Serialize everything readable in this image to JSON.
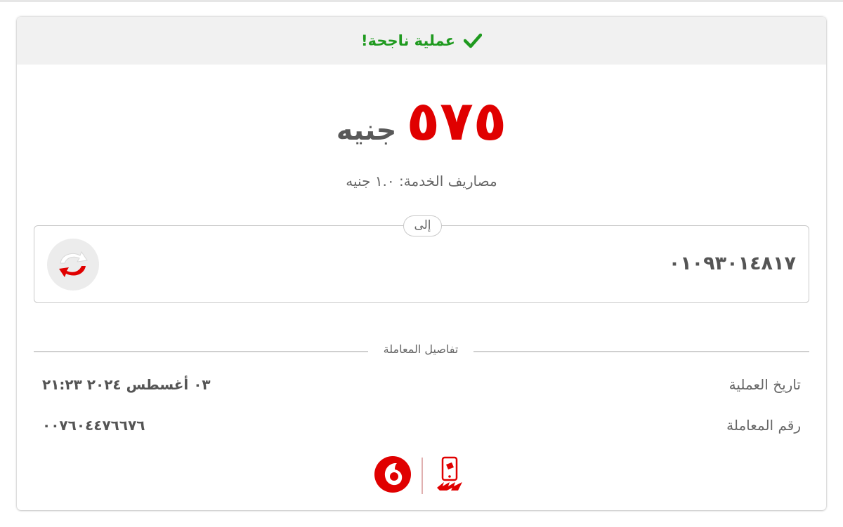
{
  "banner": {
    "status_text": "عملية ناجحة!",
    "icon": "check-icon",
    "color": "#1f9a1f"
  },
  "amount": {
    "value": "٥٧٥",
    "unit": "جنيه",
    "value_color": "#e00000"
  },
  "service_fee": "مصاريف الخدمة: ١.٠ جنيه",
  "recipient": {
    "to_label": "إلى",
    "number": "٠١٠٩٣٠١٤٨١٧",
    "icon": "refresh-icon"
  },
  "details": {
    "title": "تفاصيل المعاملة",
    "rows": [
      {
        "label": "تاريخ العملية",
        "value": "٠٣ أغسطس ٢٠٢٤  ٢١:٢٣"
      },
      {
        "label": "رقم المعاملة",
        "value": "٠٠٧٦٠٤٤٧٦٦٧٦"
      }
    ]
  },
  "logos": {
    "left": "vodafone-logo",
    "right": "vodafone-cash-logo",
    "brand_color": "#e00000"
  }
}
